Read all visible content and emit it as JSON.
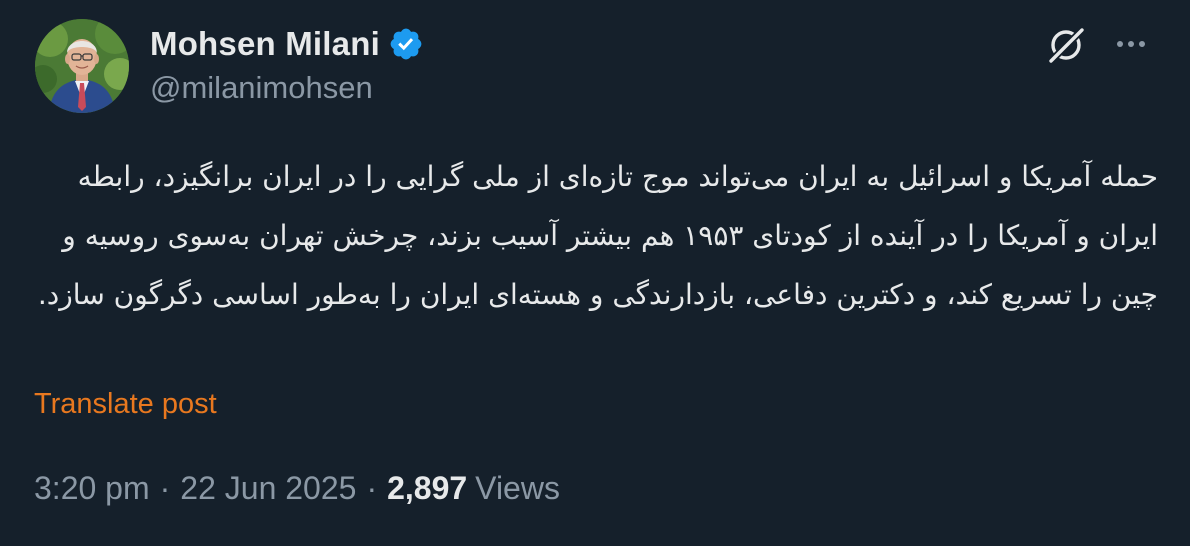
{
  "author": {
    "display_name": "Mohsen Milani",
    "handle": "@milanimohsen",
    "verified": true,
    "avatar_icon": "profile-photo"
  },
  "actions": {
    "grok_icon": "grok-slash-circle-icon",
    "more_icon": "more-horizontal-icon"
  },
  "post": {
    "text": "حمله آمریکا و اسرائیل به ایران می‌تواند موج تازه‌ای از ملی گرایی را در ایران برانگیزد،  رابطه ایران و آمریکا را در آینده از کودتای ۱۹۵۳ هم بیشتر آسیب بزند، چرخش تهران به‌سوی روسیه و چین را تسریع کند، و دکترین دفاعی، بازدارندگی و هسته‌ای ایران را به‌طور اساسی دگرگون سازد.",
    "translate_label": "Translate post"
  },
  "meta": {
    "time": "3:20 pm",
    "date": "22 Jun 2025",
    "separator": "·",
    "views_count": "2,897",
    "views_label": "Views"
  },
  "colors": {
    "background": "#15202b",
    "text_primary": "#e7e9ea",
    "text_secondary": "#8b98a5",
    "verified_blue": "#1d9bf0",
    "translate_orange": "#e8781f"
  }
}
